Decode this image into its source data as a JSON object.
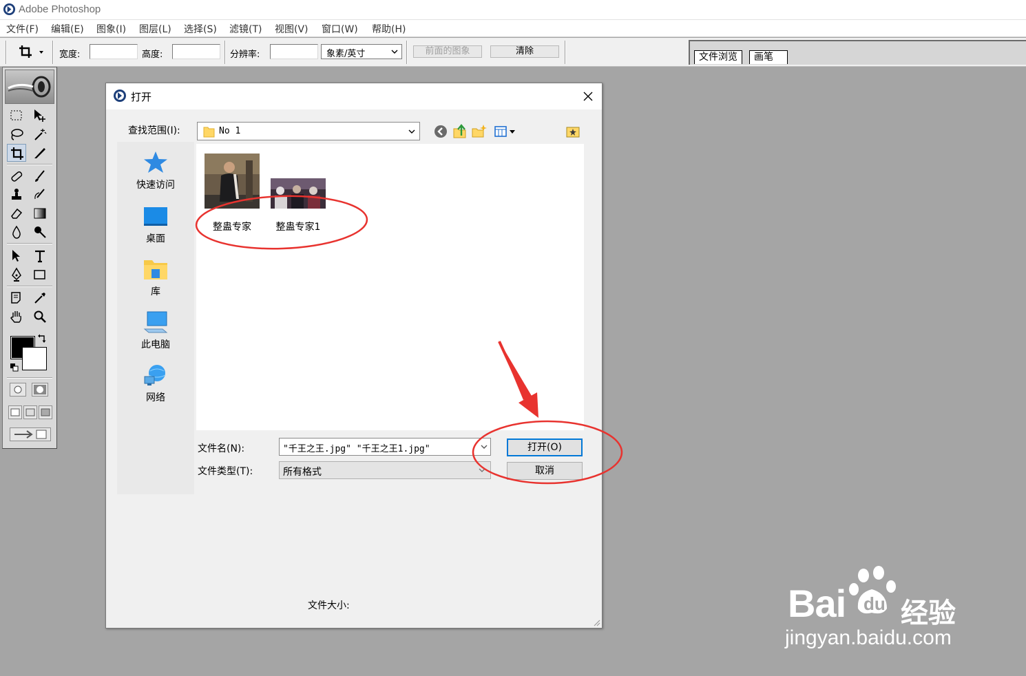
{
  "app": {
    "title": "Adobe Photoshop"
  },
  "menu": [
    {
      "label": "文件(F)"
    },
    {
      "label": "编辑(E)"
    },
    {
      "label": "图象(I)"
    },
    {
      "label": "图层(L)"
    },
    {
      "label": "选择(S)"
    },
    {
      "label": "滤镜(T)"
    },
    {
      "label": "视图(V)"
    },
    {
      "label": "窗口(W)"
    },
    {
      "label": "帮助(H)"
    }
  ],
  "options": {
    "width_label": "宽度:",
    "height_label": "高度:",
    "resolution_label": "分辨率:",
    "unit_selected": "象素/英寸",
    "front_image_label": "前面的图象",
    "clear_label": "清除"
  },
  "palette_well": {
    "tabs": [
      "文件浏览",
      "画笔"
    ]
  },
  "dialog": {
    "title": "打开",
    "lookin_label": "查找范围(I):",
    "lookin_value": "No 1",
    "places": [
      {
        "label": "快速访问",
        "icon": "star-icon"
      },
      {
        "label": "桌面",
        "icon": "desktop-icon"
      },
      {
        "label": "库",
        "icon": "library-folder-icon"
      },
      {
        "label": "此电脑",
        "icon": "computer-icon"
      },
      {
        "label": "网络",
        "icon": "network-icon"
      }
    ],
    "files": [
      {
        "name": "整蛊专家"
      },
      {
        "name": "整蛊专家1"
      }
    ],
    "filename_label": "文件名(N):",
    "filename_value": "\"千王之王.jpg\" \"千王之王1.jpg\"",
    "filetype_label": "文件类型(T):",
    "filetype_value": "所有格式",
    "open_button": "打开(O)",
    "cancel_button": "取消",
    "filesize_label": "文件大小:"
  },
  "watermark": {
    "brand": "Bai",
    "brand_cn": "经验",
    "url": "jingyan.baidu.com"
  },
  "colors": {
    "annotation": "#e8332f",
    "workspace": "#a5a5a5",
    "focus": "#0078d7"
  }
}
